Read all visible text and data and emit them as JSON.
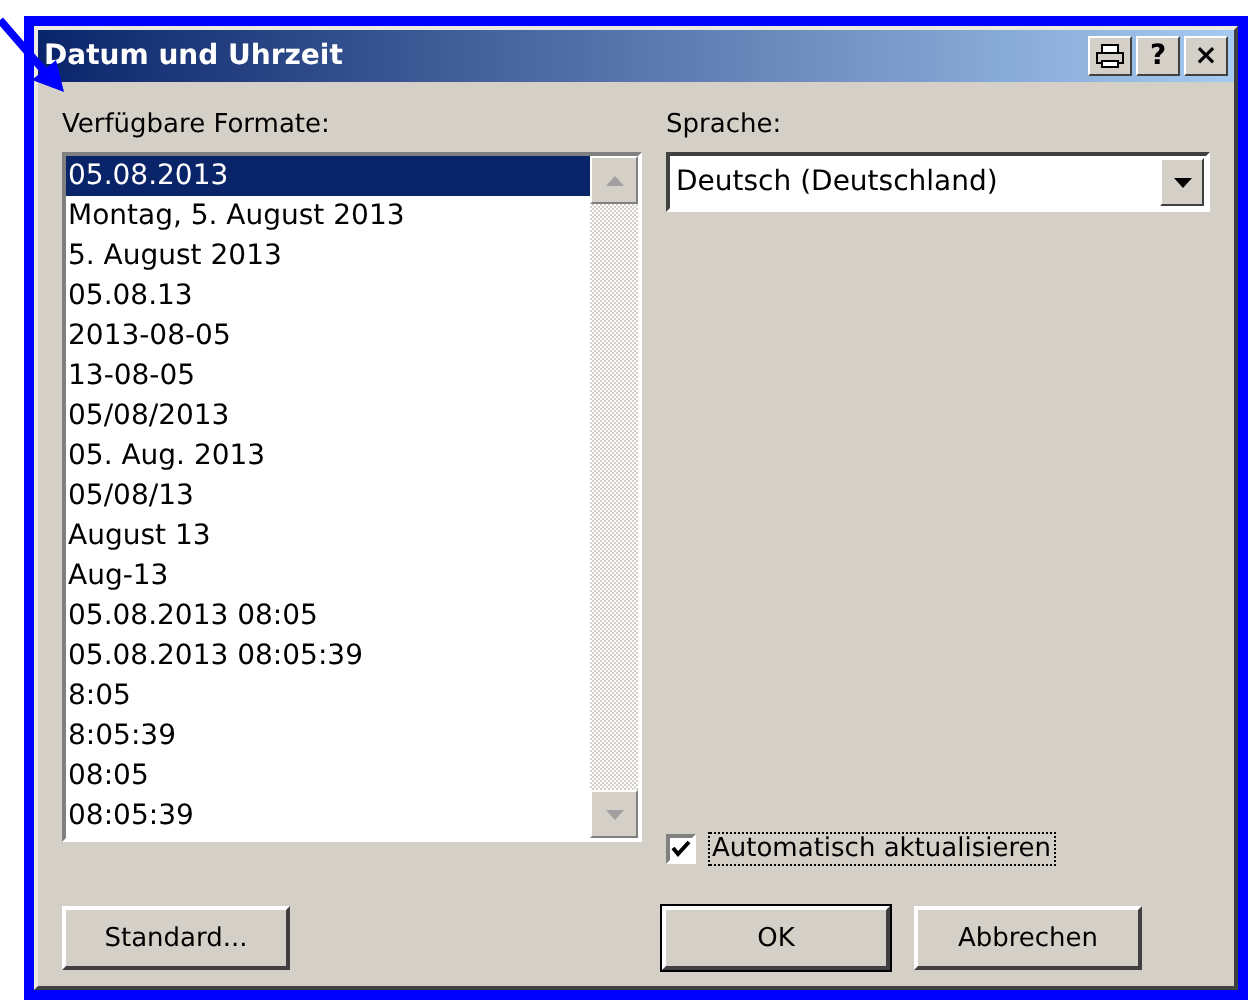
{
  "window": {
    "title": "Datum und Uhrzeit",
    "title_buttons": [
      {
        "kind": "icon"
      },
      {
        "kind": "text",
        "label": "?"
      },
      {
        "kind": "text",
        "label": "×"
      }
    ]
  },
  "formats": {
    "label": "Verfügbare Formate:",
    "items": [
      {
        "text": "05.08.2013",
        "selected": true
      },
      {
        "text": "Montag, 5. August 2013",
        "selected": false
      },
      {
        "text": "5. August 2013",
        "selected": false
      },
      {
        "text": "05.08.13",
        "selected": false
      },
      {
        "text": "2013-08-05",
        "selected": false
      },
      {
        "text": "13-08-05",
        "selected": false
      },
      {
        "text": "05/08/2013",
        "selected": false
      },
      {
        "text": "05. Aug. 2013",
        "selected": false
      },
      {
        "text": "05/08/13",
        "selected": false
      },
      {
        "text": "August 13",
        "selected": false
      },
      {
        "text": "Aug-13",
        "selected": false
      },
      {
        "text": "05.08.2013 08:05",
        "selected": false
      },
      {
        "text": "05.08.2013 08:05:39",
        "selected": false
      },
      {
        "text": "8:05",
        "selected": false
      },
      {
        "text": "8:05:39",
        "selected": false
      },
      {
        "text": "08:05",
        "selected": false
      },
      {
        "text": "08:05:39",
        "selected": false
      }
    ]
  },
  "language": {
    "label": "Sprache:",
    "value": "Deutsch (Deutschland)"
  },
  "auto_update": {
    "label": "Automatisch aktualisieren",
    "checked": true
  },
  "buttons": [
    {
      "label": "Standard...",
      "default": false
    },
    {
      "label": "OK",
      "default": true
    },
    {
      "label": "Abbrechen",
      "default": false
    }
  ]
}
